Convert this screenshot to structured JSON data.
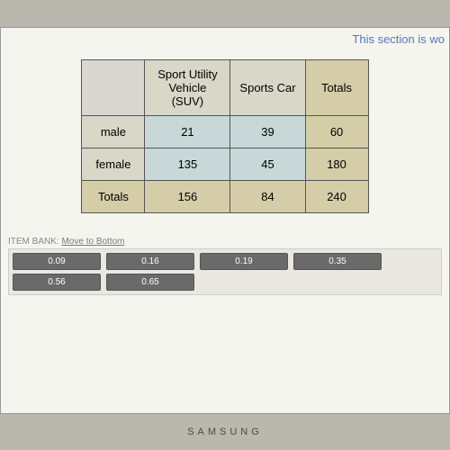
{
  "banner": "This section is wo",
  "chart_data": {
    "type": "table",
    "title": "",
    "col_headers": [
      "Sport Utility Vehicle (SUV)",
      "Sports Car",
      "Totals"
    ],
    "row_headers": [
      "male",
      "female",
      "Totals"
    ],
    "rows": [
      [
        21,
        39,
        60
      ],
      [
        135,
        45,
        180
      ],
      [
        156,
        84,
        240
      ]
    ]
  },
  "item_bank": {
    "label": "ITEM BANK:",
    "link": "Move to Bottom",
    "chips_row1": [
      "0.09",
      "0.16",
      "0.19",
      "0.35"
    ],
    "chips_row2": [
      "0.56",
      "0.65"
    ]
  },
  "device": "SAMSUNG"
}
